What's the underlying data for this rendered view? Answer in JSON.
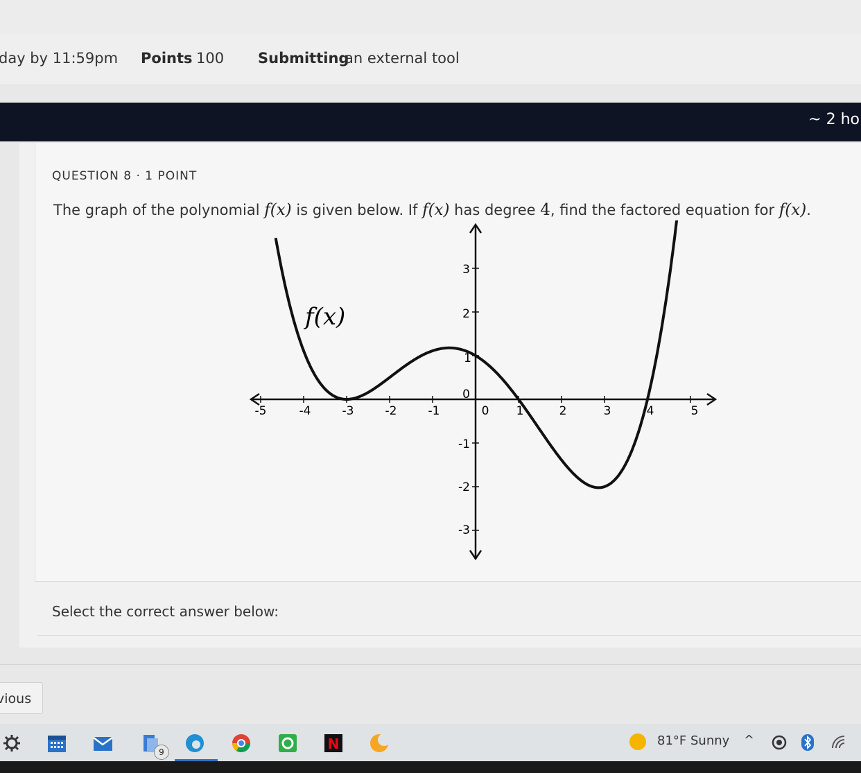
{
  "header": {
    "due": "day by 11:59pm",
    "points_label": "Points",
    "points_value": "100",
    "submitting_label": "Submitting",
    "submitting_value": "an external tool"
  },
  "timer": {
    "text": "~ 2 ho"
  },
  "question": {
    "header": "QUESTION 8 · 1 POINT",
    "text_part1": "The graph of the polynomial ",
    "text_part2": " is given below. If ",
    "text_part3": " has degree ",
    "degree": "4",
    "text_part4": ", find the factored equation for ",
    "text_part5": ".",
    "fx": "f(x)"
  },
  "graph": {
    "curve_label": "f(x)",
    "x_ticks": [
      "-5",
      "-4",
      "-3",
      "-2",
      "-1",
      "0",
      "1",
      "2",
      "3",
      "4",
      "5"
    ],
    "y_ticks": [
      "3",
      "2",
      "1",
      "0",
      "-1",
      "-2",
      "-3"
    ]
  },
  "answer": {
    "prompt": "Select the correct answer below:"
  },
  "nav": {
    "previous": "vious"
  },
  "taskbar": {
    "badge": "9",
    "weather": "81°F  Sunny",
    "icons": [
      "settings-icon",
      "calendar-icon",
      "mail-icon",
      "files-icon",
      "edge-icon",
      "chrome-icon",
      "app-icon",
      "netflix-icon",
      "moon-app-icon"
    ]
  }
}
